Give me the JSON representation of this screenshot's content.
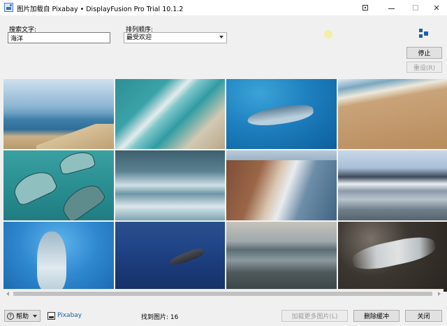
{
  "window": {
    "title": "图片加载自 Pixabay • DisplayFusion Pro Trial 10.1.2",
    "controls": {
      "close_glyph": "✕"
    }
  },
  "search": {
    "label": "搜索文字:",
    "value": "海洋"
  },
  "sort": {
    "label": "排列顺序:",
    "selected": "最受欢迎"
  },
  "buttons": {
    "stop": "停止",
    "reset": "重设(R)",
    "load_more": "加载更多图片(L)",
    "clear_cache": "删除缓冲",
    "close": "关闭"
  },
  "grid": {
    "thumbnails": [
      {
        "subject": "ocean-horizon-beach"
      },
      {
        "subject": "aerial-waves-shore"
      },
      {
        "subject": "shark-underwater"
      },
      {
        "subject": "footprints-sand"
      },
      {
        "subject": "manta-rays"
      },
      {
        "subject": "stormy-waves"
      },
      {
        "subject": "beach-shoreline"
      },
      {
        "subject": "snowy-mountains-lake"
      },
      {
        "subject": "dolphin-underwater"
      },
      {
        "subject": "dolphin-jumping"
      },
      {
        "subject": "tidal-flats"
      },
      {
        "subject": "rocks-long-exposure"
      }
    ]
  },
  "footer": {
    "help_label": "帮助",
    "help_glyph": "?",
    "source_link": "Pixabay",
    "found_label": "找到图片: 16"
  },
  "icons": {
    "app": "image-window-icon",
    "pin": "pin-icon",
    "brand": "displayfusion-logo-icon"
  }
}
